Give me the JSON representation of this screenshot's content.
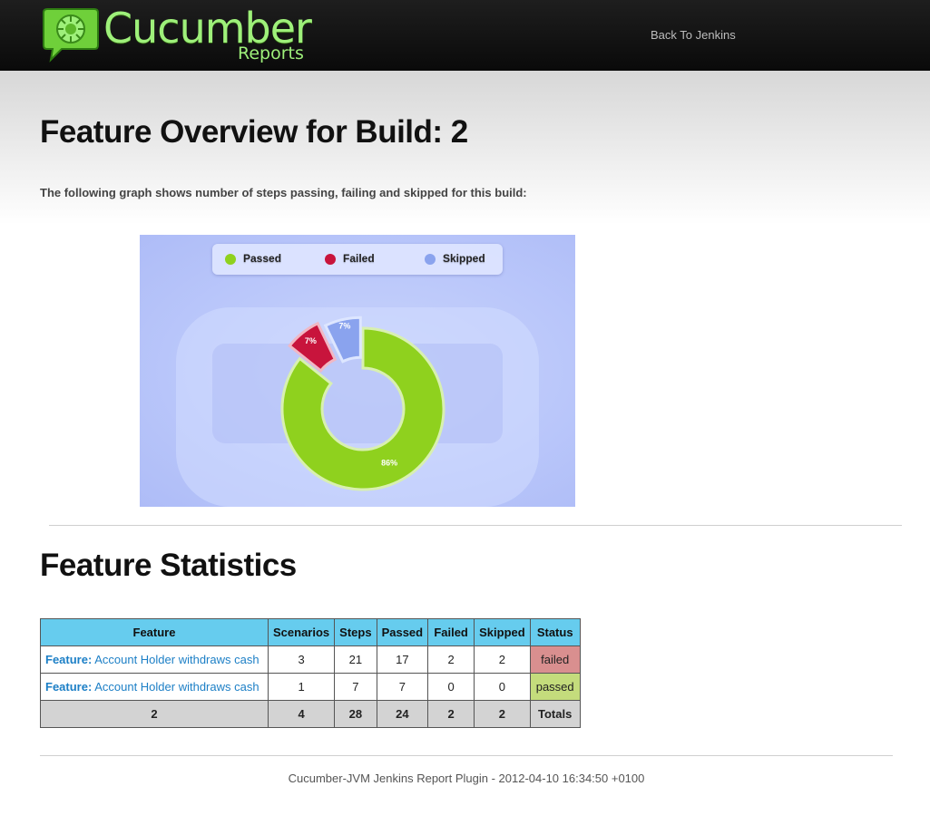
{
  "header": {
    "logo_title": "Cucumber",
    "logo_subtitle": "Reports",
    "back_link": "Back To Jenkins"
  },
  "page": {
    "title": "Feature Overview for Build: 2",
    "intro": "The following graph shows number of steps passing, failing and skipped for this build:"
  },
  "chart_data": {
    "type": "pie",
    "style": "donut",
    "categories": [
      "Passed",
      "Failed",
      "Skipped"
    ],
    "values": [
      24,
      2,
      2
    ],
    "percent_labels": [
      "86%",
      "7%",
      "7%"
    ],
    "colors": [
      "#8fd11e",
      "#c8143c",
      "#8aa3ee"
    ],
    "legend": "top"
  },
  "stats": {
    "title": "Feature Statistics",
    "columns": [
      "Feature",
      "Scenarios",
      "Steps",
      "Passed",
      "Failed",
      "Skipped",
      "Status"
    ],
    "rows": [
      {
        "prefix": "Feature:",
        "name": "Account Holder withdraws cash",
        "scenarios": "3",
        "steps": "21",
        "passed": "17",
        "failed": "2",
        "skipped": "2",
        "status": "failed"
      },
      {
        "prefix": "Feature:",
        "name": "Account Holder withdraws cash",
        "scenarios": "1",
        "steps": "7",
        "passed": "7",
        "failed": "0",
        "skipped": "0",
        "status": "passed"
      }
    ],
    "totals": {
      "features": "2",
      "scenarios": "4",
      "steps": "28",
      "passed": "24",
      "failed": "2",
      "skipped": "2",
      "label": "Totals"
    }
  },
  "footer": {
    "text": "Cucumber-JVM Jenkins Report Plugin - 2012-04-10 16:34:50 +0100"
  },
  "colors": {
    "accent_green": "#9ef07a",
    "header_bg": "#111111",
    "table_header": "#66ccee",
    "status_failed": "#d98f8f",
    "status_passed": "#c4dc7c"
  }
}
